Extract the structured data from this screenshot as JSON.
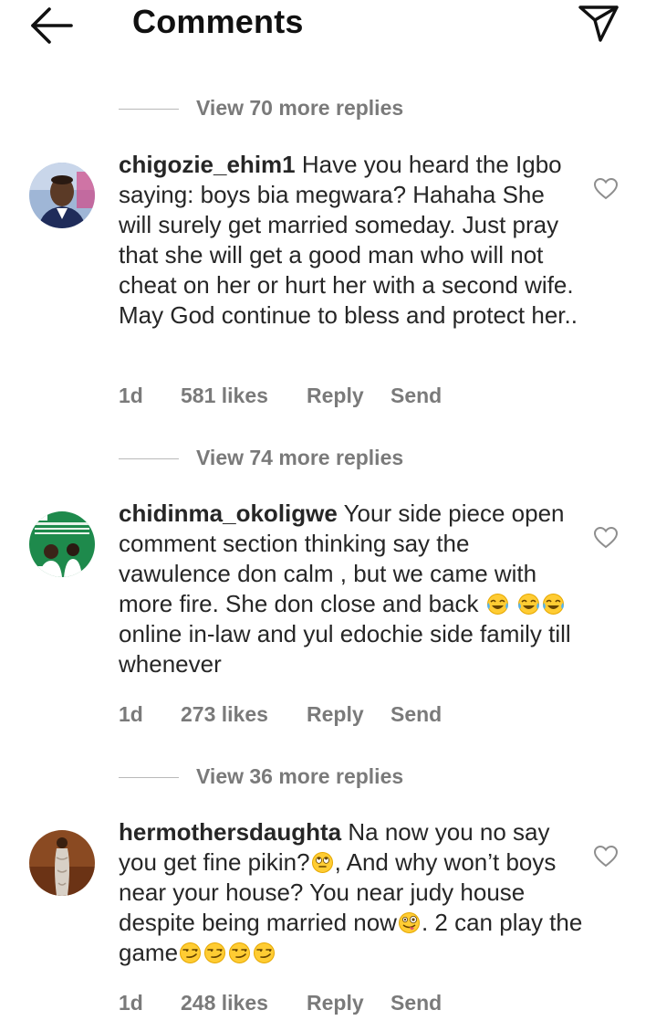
{
  "header": {
    "title": "Comments"
  },
  "threads": [
    {
      "view_more": "View 70 more replies"
    },
    {
      "view_more": "View 74 more replies"
    },
    {
      "view_more": "View 36 more replies"
    }
  ],
  "comments": [
    {
      "username": "chigozie_ehim1",
      "text": "Have you heard the Igbo saying: boys bia megwara? Hahaha She will surely get married someday. Just pray that she will get a good man who will not cheat on her or hurt her with a second wife. May God continue to bless and protect her..",
      "time": "1d",
      "likes": "581 likes",
      "reply": "Reply",
      "send": "Send"
    },
    {
      "username": "chidinma_okoligwe",
      "text_1": "Your side piece open comment section thinking say the vawulence don calm , but we came with more fire. She don close and back",
      "text_2": "online in-law and yul edochie side family till whenever",
      "time": "1d",
      "likes": "273 likes",
      "reply": "Reply",
      "send": "Send"
    },
    {
      "username": "hermothersdaughta",
      "text_1": "Na now you no say you get fine pikin?",
      "text_2": ", And why won’t boys near your house? You near judy house despite being married now",
      "text_3": ". 2 can play the game",
      "time": "1d",
      "likes": "248 likes",
      "reply": "Reply",
      "send": "Send"
    }
  ],
  "icons": {
    "back": "arrow-left-icon",
    "send": "paper-plane-icon",
    "like": "heart-outline-icon",
    "laugh": "tears-of-joy-emoji",
    "eyeroll": "eye-roll-emoji",
    "zany": "zany-face-emoji",
    "smirk": "smirk-emoji"
  }
}
